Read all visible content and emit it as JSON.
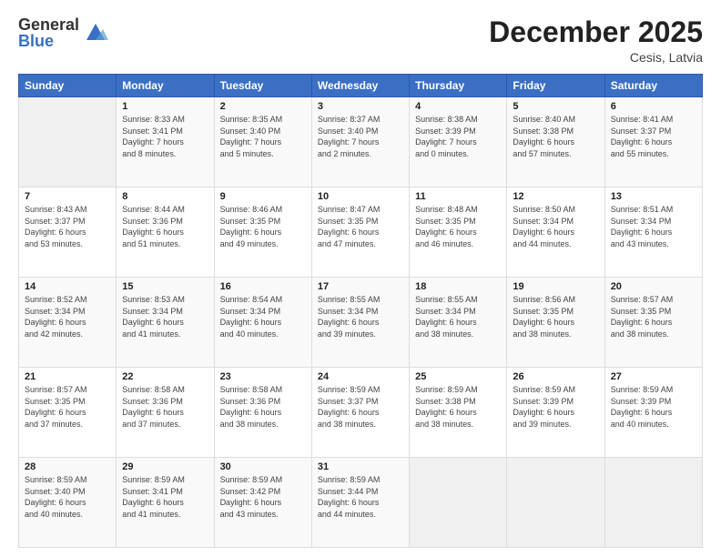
{
  "header": {
    "logo_general": "General",
    "logo_blue": "Blue",
    "month_title": "December 2025",
    "location": "Cesis, Latvia"
  },
  "days_of_week": [
    "Sunday",
    "Monday",
    "Tuesday",
    "Wednesday",
    "Thursday",
    "Friday",
    "Saturday"
  ],
  "weeks": [
    [
      {
        "day": "",
        "info": ""
      },
      {
        "day": "1",
        "info": "Sunrise: 8:33 AM\nSunset: 3:41 PM\nDaylight: 7 hours\nand 8 minutes."
      },
      {
        "day": "2",
        "info": "Sunrise: 8:35 AM\nSunset: 3:40 PM\nDaylight: 7 hours\nand 5 minutes."
      },
      {
        "day": "3",
        "info": "Sunrise: 8:37 AM\nSunset: 3:40 PM\nDaylight: 7 hours\nand 2 minutes."
      },
      {
        "day": "4",
        "info": "Sunrise: 8:38 AM\nSunset: 3:39 PM\nDaylight: 7 hours\nand 0 minutes."
      },
      {
        "day": "5",
        "info": "Sunrise: 8:40 AM\nSunset: 3:38 PM\nDaylight: 6 hours\nand 57 minutes."
      },
      {
        "day": "6",
        "info": "Sunrise: 8:41 AM\nSunset: 3:37 PM\nDaylight: 6 hours\nand 55 minutes."
      }
    ],
    [
      {
        "day": "7",
        "info": "Sunrise: 8:43 AM\nSunset: 3:37 PM\nDaylight: 6 hours\nand 53 minutes."
      },
      {
        "day": "8",
        "info": "Sunrise: 8:44 AM\nSunset: 3:36 PM\nDaylight: 6 hours\nand 51 minutes."
      },
      {
        "day": "9",
        "info": "Sunrise: 8:46 AM\nSunset: 3:35 PM\nDaylight: 6 hours\nand 49 minutes."
      },
      {
        "day": "10",
        "info": "Sunrise: 8:47 AM\nSunset: 3:35 PM\nDaylight: 6 hours\nand 47 minutes."
      },
      {
        "day": "11",
        "info": "Sunrise: 8:48 AM\nSunset: 3:35 PM\nDaylight: 6 hours\nand 46 minutes."
      },
      {
        "day": "12",
        "info": "Sunrise: 8:50 AM\nSunset: 3:34 PM\nDaylight: 6 hours\nand 44 minutes."
      },
      {
        "day": "13",
        "info": "Sunrise: 8:51 AM\nSunset: 3:34 PM\nDaylight: 6 hours\nand 43 minutes."
      }
    ],
    [
      {
        "day": "14",
        "info": "Sunrise: 8:52 AM\nSunset: 3:34 PM\nDaylight: 6 hours\nand 42 minutes."
      },
      {
        "day": "15",
        "info": "Sunrise: 8:53 AM\nSunset: 3:34 PM\nDaylight: 6 hours\nand 41 minutes."
      },
      {
        "day": "16",
        "info": "Sunrise: 8:54 AM\nSunset: 3:34 PM\nDaylight: 6 hours\nand 40 minutes."
      },
      {
        "day": "17",
        "info": "Sunrise: 8:55 AM\nSunset: 3:34 PM\nDaylight: 6 hours\nand 39 minutes."
      },
      {
        "day": "18",
        "info": "Sunrise: 8:55 AM\nSunset: 3:34 PM\nDaylight: 6 hours\nand 38 minutes."
      },
      {
        "day": "19",
        "info": "Sunrise: 8:56 AM\nSunset: 3:35 PM\nDaylight: 6 hours\nand 38 minutes."
      },
      {
        "day": "20",
        "info": "Sunrise: 8:57 AM\nSunset: 3:35 PM\nDaylight: 6 hours\nand 38 minutes."
      }
    ],
    [
      {
        "day": "21",
        "info": "Sunrise: 8:57 AM\nSunset: 3:35 PM\nDaylight: 6 hours\nand 37 minutes."
      },
      {
        "day": "22",
        "info": "Sunrise: 8:58 AM\nSunset: 3:36 PM\nDaylight: 6 hours\nand 37 minutes."
      },
      {
        "day": "23",
        "info": "Sunrise: 8:58 AM\nSunset: 3:36 PM\nDaylight: 6 hours\nand 38 minutes."
      },
      {
        "day": "24",
        "info": "Sunrise: 8:59 AM\nSunset: 3:37 PM\nDaylight: 6 hours\nand 38 minutes."
      },
      {
        "day": "25",
        "info": "Sunrise: 8:59 AM\nSunset: 3:38 PM\nDaylight: 6 hours\nand 38 minutes."
      },
      {
        "day": "26",
        "info": "Sunrise: 8:59 AM\nSunset: 3:39 PM\nDaylight: 6 hours\nand 39 minutes."
      },
      {
        "day": "27",
        "info": "Sunrise: 8:59 AM\nSunset: 3:39 PM\nDaylight: 6 hours\nand 40 minutes."
      }
    ],
    [
      {
        "day": "28",
        "info": "Sunrise: 8:59 AM\nSunset: 3:40 PM\nDaylight: 6 hours\nand 40 minutes."
      },
      {
        "day": "29",
        "info": "Sunrise: 8:59 AM\nSunset: 3:41 PM\nDaylight: 6 hours\nand 41 minutes."
      },
      {
        "day": "30",
        "info": "Sunrise: 8:59 AM\nSunset: 3:42 PM\nDaylight: 6 hours\nand 43 minutes."
      },
      {
        "day": "31",
        "info": "Sunrise: 8:59 AM\nSunset: 3:44 PM\nDaylight: 6 hours\nand 44 minutes."
      },
      {
        "day": "",
        "info": ""
      },
      {
        "day": "",
        "info": ""
      },
      {
        "day": "",
        "info": ""
      }
    ]
  ]
}
